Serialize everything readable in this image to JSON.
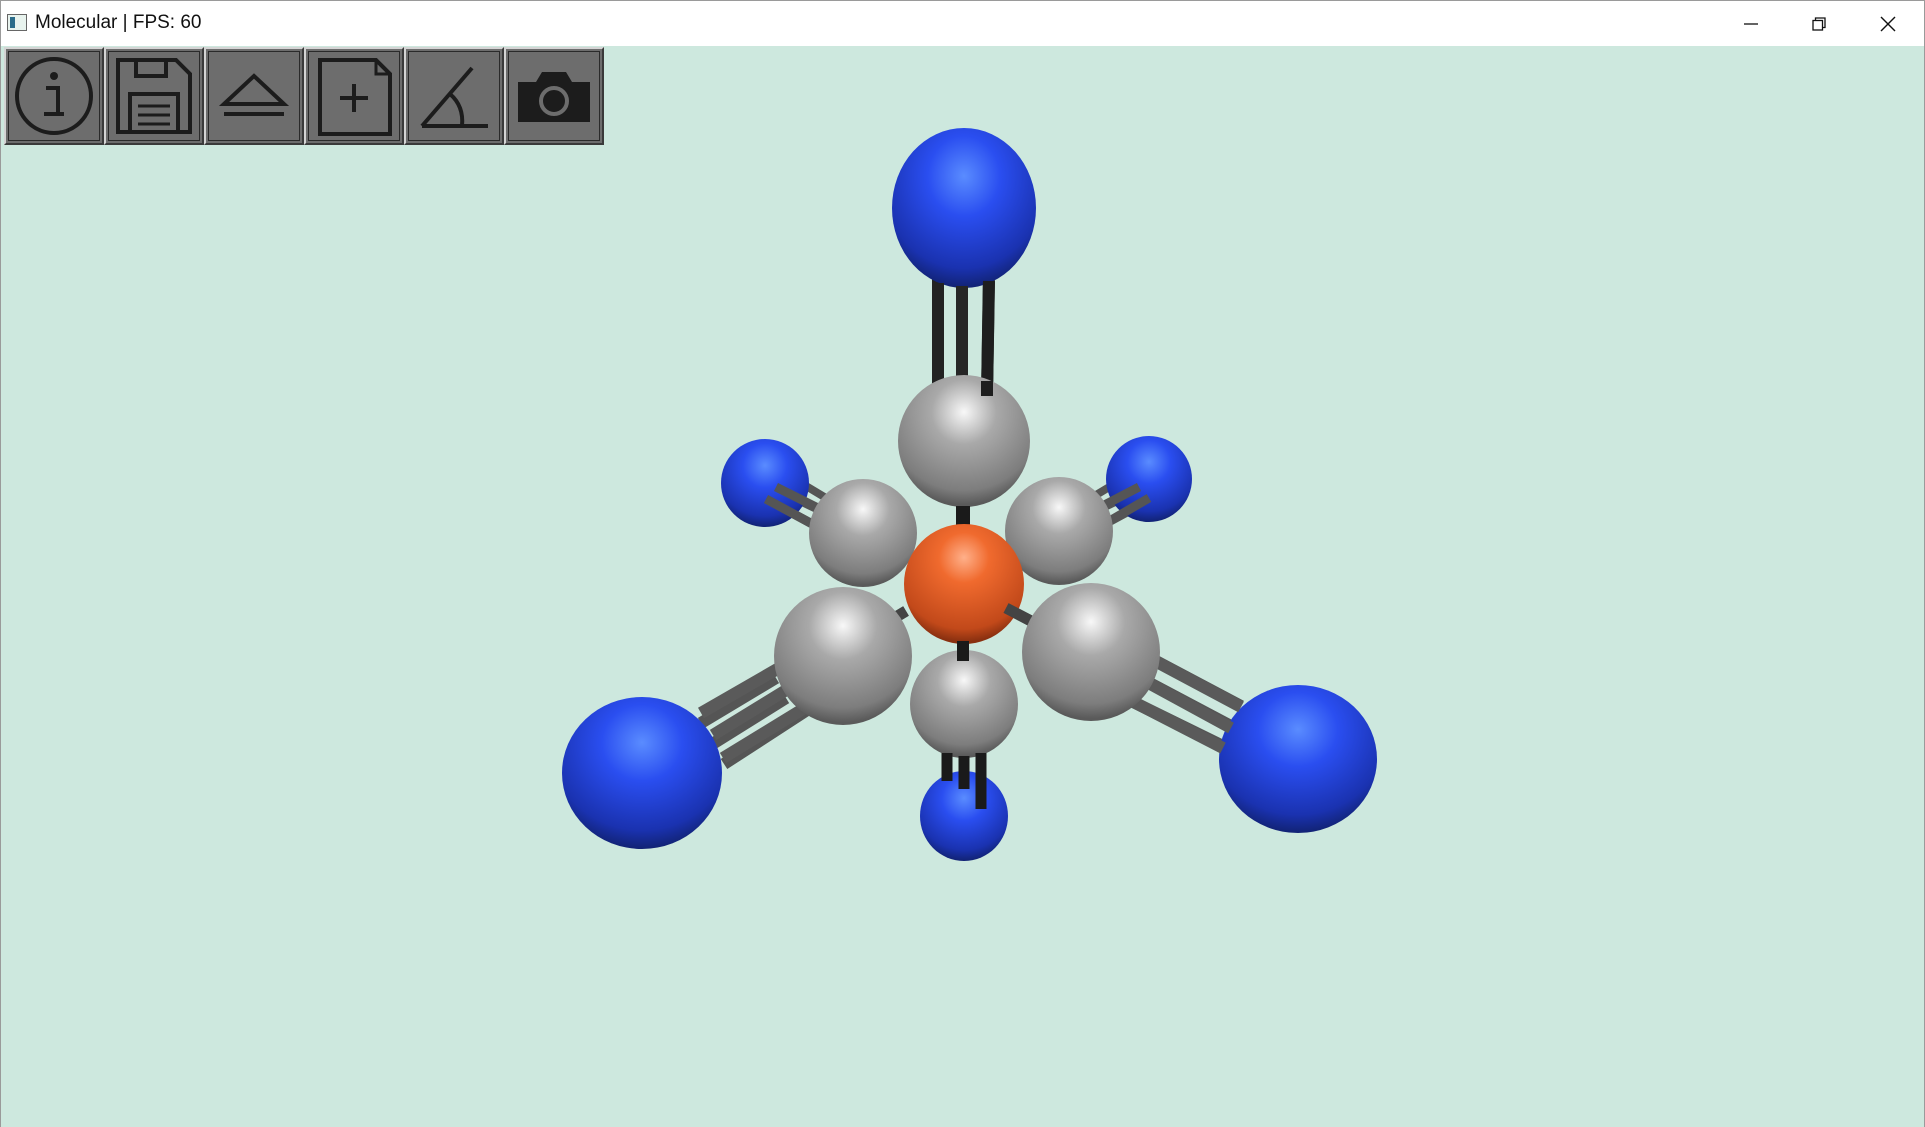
{
  "window": {
    "title": "Molecular | FPS: 60",
    "controls": [
      "minimize-icon",
      "restore-icon",
      "close-icon"
    ]
  },
  "toolbar": {
    "buttons": [
      {
        "icon": "info-icon"
      },
      {
        "icon": "save-icon"
      },
      {
        "icon": "eject-icon"
      },
      {
        "icon": "new-file-icon"
      },
      {
        "icon": "angle-icon"
      },
      {
        "icon": "camera-icon"
      }
    ]
  },
  "viewport": {
    "background": "#cde8de",
    "atom_colors": {
      "metal": "#e06030",
      "carbon": "#9a9a9a",
      "nitrogen": "#2244dd"
    },
    "bond_color": "#2a2a2a"
  }
}
